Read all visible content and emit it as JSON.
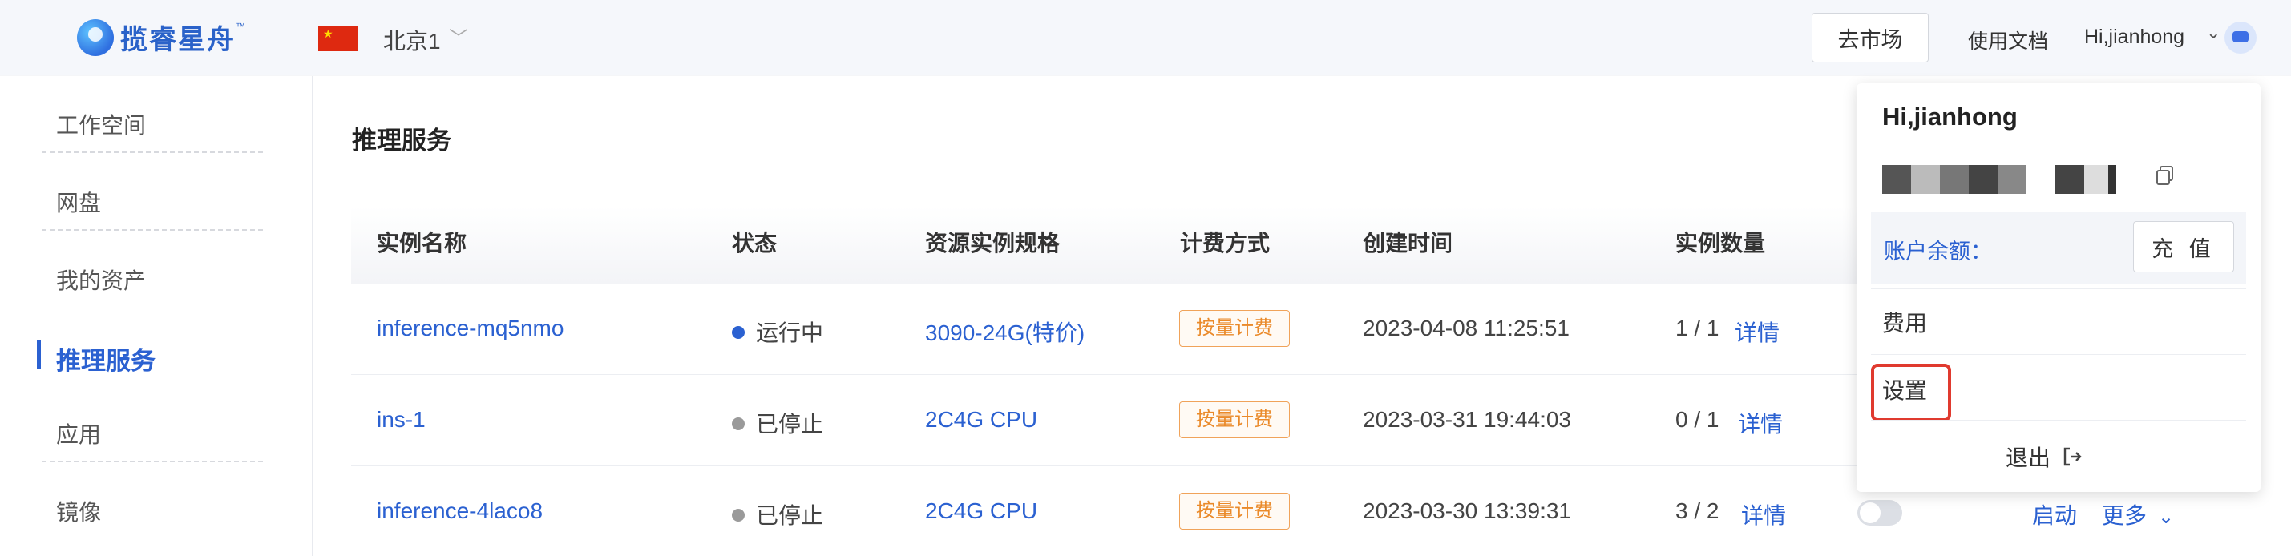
{
  "header": {
    "logo_text": "揽睿星舟",
    "logo_tm": "™",
    "region": "北京1",
    "market_button": "去市场",
    "docs_link": "使用文档",
    "user_greeting": "Hi,jianhong"
  },
  "sidebar": {
    "items": [
      {
        "label": "工作空间"
      },
      {
        "label": "网盘"
      },
      {
        "label": "我的资产"
      },
      {
        "label": "推理服务",
        "active": true
      },
      {
        "label": "应用"
      },
      {
        "label": "镜像"
      }
    ]
  },
  "main": {
    "title": "推理服务",
    "columns": [
      "实例名称",
      "状态",
      "资源实例规格",
      "计费方式",
      "创建时间",
      "实例数量"
    ],
    "rows": [
      {
        "name": "inference-mq5nmo",
        "status": "运行中",
        "status_color": "#2b61d1",
        "spec": "3090-24G(特价)",
        "billing": "按量计费",
        "created": "2023-04-08 11:25:51",
        "count": "1 / 1",
        "detail": "详情"
      },
      {
        "name": "ins-1",
        "status": "已停止",
        "status_color": "#9a9a9a",
        "spec": "2C4G CPU",
        "billing": "按量计费",
        "created": "2023-03-31 19:44:03",
        "count": "0 / 1",
        "detail": "详情"
      },
      {
        "name": "inference-4laco8",
        "status": "已停止",
        "status_color": "#9a9a9a",
        "spec": "2C4G CPU",
        "billing": "按量计费",
        "created": "2023-03-30 13:39:31",
        "count": "3 / 2",
        "detail": "详情",
        "start": "启动",
        "more": "更多"
      }
    ]
  },
  "user_menu": {
    "name": "Hi,jianhong",
    "balance_label": "账户余额：",
    "recharge_button": "充 值",
    "items": [
      "费用",
      "设置"
    ],
    "logout": "退出"
  },
  "colors": {
    "accent": "#2b61d1",
    "tag_orange": "#ea8a2a",
    "highlight_red": "#e03a2f"
  }
}
